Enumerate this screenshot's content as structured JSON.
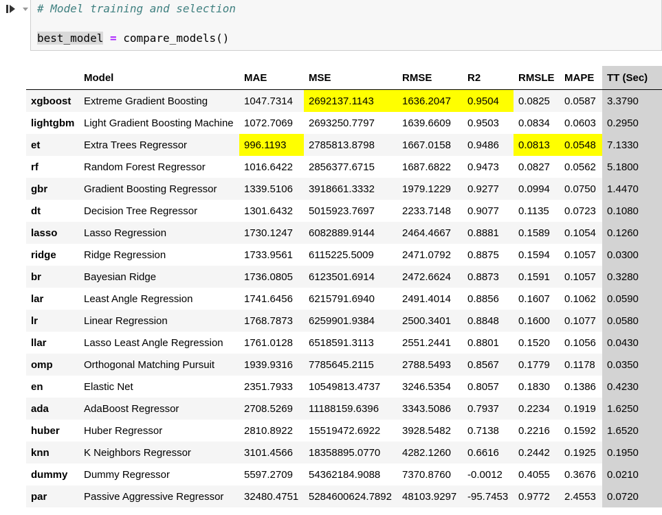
{
  "cell": {
    "comment": "# Model training and selection",
    "code_var": "best_model",
    "code_op": "=",
    "code_call": "compare_models()"
  },
  "table": {
    "headers": [
      "",
      "Model",
      "MAE",
      "MSE",
      "RMSE",
      "R2",
      "RMSLE",
      "MAPE",
      "TT (Sec)"
    ],
    "highlight_color": "#ffff00",
    "tt_column_color": "#d3d3d3",
    "rows": [
      {
        "idx": "xgboost",
        "cells": [
          "Extreme Gradient Boosting",
          "1047.7314",
          "2692137.1143",
          "1636.2047",
          "0.9504",
          "0.0825",
          "0.0587",
          "3.3790"
        ],
        "hl": [
          false,
          false,
          true,
          true,
          true,
          false,
          false,
          false
        ]
      },
      {
        "idx": "lightgbm",
        "cells": [
          "Light Gradient Boosting Machine",
          "1072.7069",
          "2693250.7797",
          "1639.6609",
          "0.9503",
          "0.0834",
          "0.0603",
          "0.2950"
        ],
        "hl": [
          false,
          false,
          false,
          false,
          false,
          false,
          false,
          false
        ]
      },
      {
        "idx": "et",
        "cells": [
          "Extra Trees Regressor",
          "996.1193",
          "2785813.8798",
          "1667.0158",
          "0.9486",
          "0.0813",
          "0.0548",
          "7.1330"
        ],
        "hl": [
          false,
          true,
          false,
          false,
          false,
          true,
          true,
          false
        ]
      },
      {
        "idx": "rf",
        "cells": [
          "Random Forest Regressor",
          "1016.6422",
          "2856377.6715",
          "1687.6822",
          "0.9473",
          "0.0827",
          "0.0562",
          "5.1800"
        ],
        "hl": [
          false,
          false,
          false,
          false,
          false,
          false,
          false,
          false
        ]
      },
      {
        "idx": "gbr",
        "cells": [
          "Gradient Boosting Regressor",
          "1339.5106",
          "3918661.3332",
          "1979.1229",
          "0.9277",
          "0.0994",
          "0.0750",
          "1.4470"
        ],
        "hl": [
          false,
          false,
          false,
          false,
          false,
          false,
          false,
          false
        ]
      },
      {
        "idx": "dt",
        "cells": [
          "Decision Tree Regressor",
          "1301.6432",
          "5015923.7697",
          "2233.7148",
          "0.9077",
          "0.1135",
          "0.0723",
          "0.1080"
        ],
        "hl": [
          false,
          false,
          false,
          false,
          false,
          false,
          false,
          false
        ]
      },
      {
        "idx": "lasso",
        "cells": [
          "Lasso Regression",
          "1730.1247",
          "6082889.9144",
          "2464.4667",
          "0.8881",
          "0.1589",
          "0.1054",
          "0.1260"
        ],
        "hl": [
          false,
          false,
          false,
          false,
          false,
          false,
          false,
          false
        ]
      },
      {
        "idx": "ridge",
        "cells": [
          "Ridge Regression",
          "1733.9561",
          "6115225.5009",
          "2471.0792",
          "0.8875",
          "0.1594",
          "0.1057",
          "0.0300"
        ],
        "hl": [
          false,
          false,
          false,
          false,
          false,
          false,
          false,
          false
        ]
      },
      {
        "idx": "br",
        "cells": [
          "Bayesian Ridge",
          "1736.0805",
          "6123501.6914",
          "2472.6624",
          "0.8873",
          "0.1591",
          "0.1057",
          "0.3280"
        ],
        "hl": [
          false,
          false,
          false,
          false,
          false,
          false,
          false,
          false
        ]
      },
      {
        "idx": "lar",
        "cells": [
          "Least Angle Regression",
          "1741.6456",
          "6215791.6940",
          "2491.4014",
          "0.8856",
          "0.1607",
          "0.1062",
          "0.0590"
        ],
        "hl": [
          false,
          false,
          false,
          false,
          false,
          false,
          false,
          false
        ]
      },
      {
        "idx": "lr",
        "cells": [
          "Linear Regression",
          "1768.7873",
          "6259901.9384",
          "2500.3401",
          "0.8848",
          "0.1600",
          "0.1077",
          "0.0580"
        ],
        "hl": [
          false,
          false,
          false,
          false,
          false,
          false,
          false,
          false
        ]
      },
      {
        "idx": "llar",
        "cells": [
          "Lasso Least Angle Regression",
          "1761.0128",
          "6518591.3113",
          "2551.2441",
          "0.8801",
          "0.1520",
          "0.1056",
          "0.0430"
        ],
        "hl": [
          false,
          false,
          false,
          false,
          false,
          false,
          false,
          false
        ]
      },
      {
        "idx": "omp",
        "cells": [
          "Orthogonal Matching Pursuit",
          "1939.9316",
          "7785645.2115",
          "2788.5493",
          "0.8567",
          "0.1779",
          "0.1178",
          "0.0350"
        ],
        "hl": [
          false,
          false,
          false,
          false,
          false,
          false,
          false,
          false
        ]
      },
      {
        "idx": "en",
        "cells": [
          "Elastic Net",
          "2351.7933",
          "10549813.4737",
          "3246.5354",
          "0.8057",
          "0.1830",
          "0.1386",
          "0.4230"
        ],
        "hl": [
          false,
          false,
          false,
          false,
          false,
          false,
          false,
          false
        ]
      },
      {
        "idx": "ada",
        "cells": [
          "AdaBoost Regressor",
          "2708.5269",
          "11188159.6396",
          "3343.5086",
          "0.7937",
          "0.2234",
          "0.1919",
          "1.6250"
        ],
        "hl": [
          false,
          false,
          false,
          false,
          false,
          false,
          false,
          false
        ]
      },
      {
        "idx": "huber",
        "cells": [
          "Huber Regressor",
          "2810.8922",
          "15519472.6922",
          "3928.5482",
          "0.7138",
          "0.2216",
          "0.1592",
          "1.6520"
        ],
        "hl": [
          false,
          false,
          false,
          false,
          false,
          false,
          false,
          false
        ]
      },
      {
        "idx": "knn",
        "cells": [
          "K Neighbors Regressor",
          "3101.4566",
          "18358895.0770",
          "4282.1260",
          "0.6616",
          "0.2442",
          "0.1925",
          "0.1950"
        ],
        "hl": [
          false,
          false,
          false,
          false,
          false,
          false,
          false,
          false
        ]
      },
      {
        "idx": "dummy",
        "cells": [
          "Dummy Regressor",
          "5597.2709",
          "54362184.9088",
          "7370.8760",
          "-0.0012",
          "0.4055",
          "0.3676",
          "0.0210"
        ],
        "hl": [
          false,
          false,
          false,
          false,
          false,
          false,
          false,
          false
        ]
      },
      {
        "idx": "par",
        "cells": [
          "Passive Aggressive Regressor",
          "32480.4751",
          "5284600624.7892",
          "48103.9297",
          "-95.7453",
          "0.9772",
          "2.4553",
          "0.0720"
        ],
        "hl": [
          false,
          false,
          false,
          false,
          false,
          false,
          false,
          false
        ]
      }
    ]
  }
}
